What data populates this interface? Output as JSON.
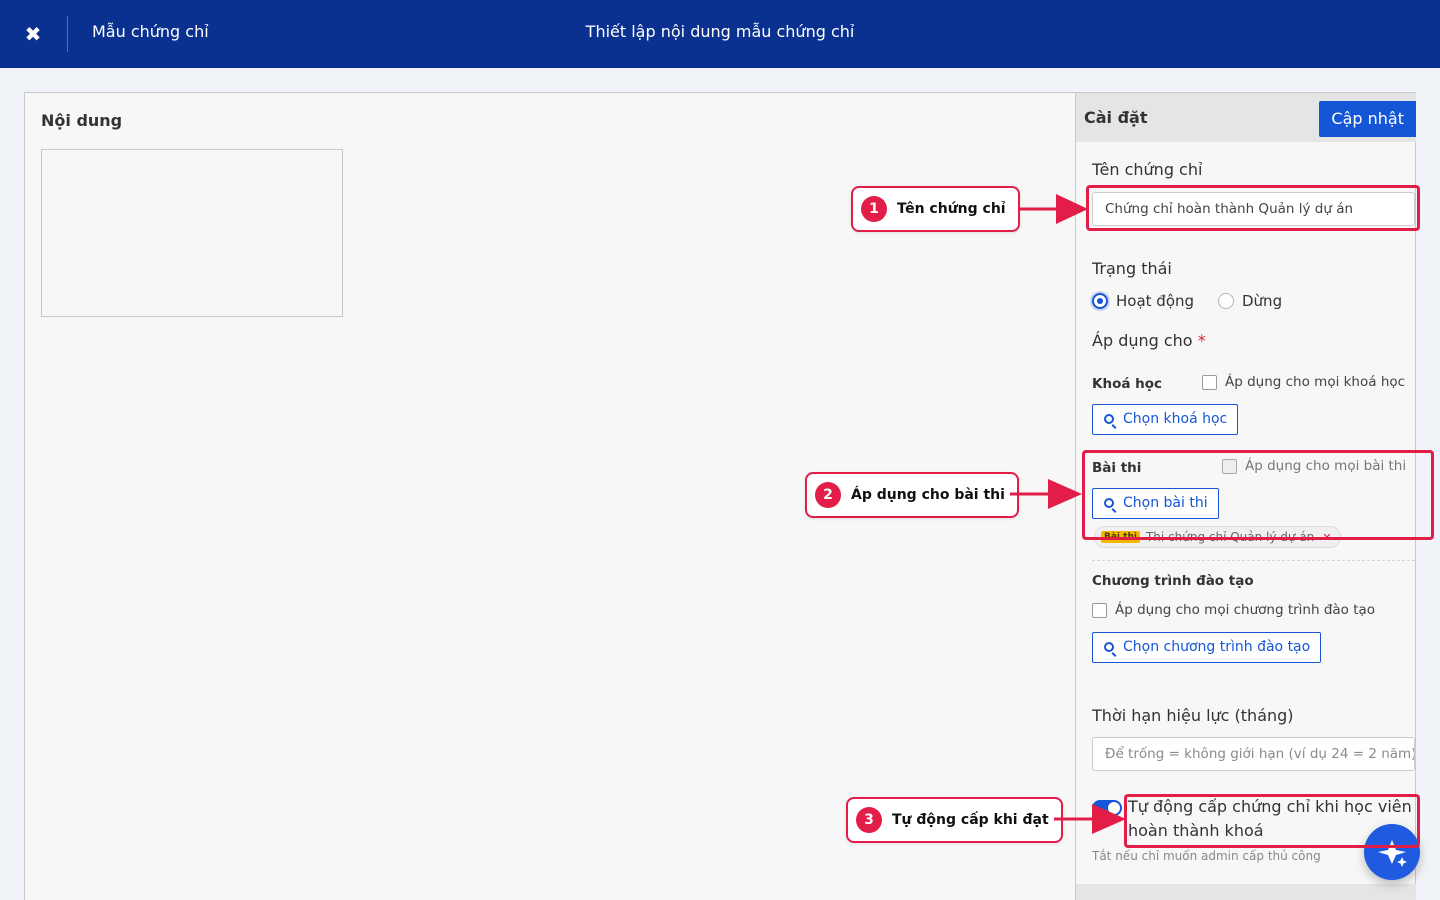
{
  "topbar": {
    "close_icon": "close-icon",
    "breadcrumb": "Mẫu chứng chỉ",
    "title": "Thiết lập nội dung mẫu chứng chỉ"
  },
  "editor": {
    "label": "Nội dung"
  },
  "settings": {
    "header": "Cài đặt",
    "update_button": "Cập nhật",
    "name_label": "Tên chứng chỉ",
    "name_value": "Chứng chỉ hoàn thành Quản lý dự án",
    "status_label": "Trạng thái",
    "status_options": [
      "Hoạt động",
      "Dừng"
    ],
    "status_selected": "Hoạt động",
    "apply_label": "Áp dụng cho",
    "required_mark": "*",
    "course": {
      "label": "Khoá học",
      "all_label": "Áp dụng cho mọi khoá học",
      "pick_button": "Chọn khoá học"
    },
    "exam": {
      "label": "Bài thi",
      "all_label": "Áp dụng cho mọi bài thi",
      "pick_button": "Chọn bài thi",
      "chip_tag": "Bài thi",
      "chip_text": "Thi chứng chỉ Quản lý dự án",
      "chip_remove": "✕"
    },
    "program": {
      "label": "Chương trình đào tạo",
      "all_label": "Áp dụng cho mọi chương trình đào tạo",
      "pick_button": "Chọn chương trình đào tạo"
    },
    "validity_label": "Thời hạn hiệu lực (tháng)",
    "validity_placeholder": "Để trống = không giới hạn (ví dụ 24 = 2 năm)",
    "auto_issue_text": "Tự động cấp chứng chỉ khi học viên hoàn thành khoá",
    "auto_issue_enabled": true,
    "auto_issue_hint": "Tắt nếu chỉ muốn admin cấp thủ công"
  },
  "annotations": [
    {
      "num": "1",
      "text": "Tên chứng chỉ"
    },
    {
      "num": "2",
      "text": "Áp dụng cho bài thi"
    },
    {
      "num": "3",
      "text": "Tự động cấp khi đạt"
    }
  ],
  "colors": {
    "topbar": "#0a3190",
    "accent": "#1556d6",
    "annotation": "#e11d48",
    "chip_tag": "#f5b800"
  },
  "fab_icon": "sparkle-icon"
}
